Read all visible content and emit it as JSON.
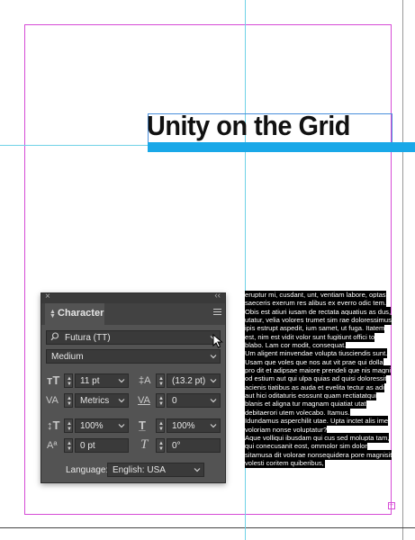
{
  "document": {
    "headline": "Unity on the Grid",
    "body_text": "eruptur mi, cusdant, unt, ventiam labore, optas saeceris exerum res alibus ex everro odic tem. Obis est atiuri iusam de rectata aquatius as dus, utatur, velia volores trumet sim rae doloressimus ipis estrupt aspedit, ium samet, ut fuga. Itatem est, nim est vidit volor sunt fugitiunt offici to blabo. Lam cor modit, consequat.\nUm aligent minvendae volupta tiusciendis sunt.\nUsam que voles que nos aut vit prae qui dolla pro dit et adipsae maiore prendeli que nis magni od estium aut qui ulpa quias ad quisi doloressit acienis tiatibus as auda et evelita tectur as adi aut hici oditaturis eossunt quam rectiatatqui blanis et aligna tur magnam quiatiat utat debitaerori utem volecabo. Itamus.\nIdundamus asperchilit utae. Upta inctet alis ime voloriam nonse voluptatur?\nAque volliqui ibusdam qui cus sed molupta tam, qui conecusanit eost, ommolor sim dolor sitamusa dit volorae nonsequidera pore magnisit volesti coritem quiberibus,"
  },
  "character_panel": {
    "tab_label": "Character",
    "font_family": "Futura (TT)",
    "font_style": "Medium",
    "font_size": "11 pt",
    "leading": "(13.2 pt)",
    "kerning": "Metrics",
    "tracking": "0",
    "vertical_scale": "100%",
    "horizontal_scale": "100%",
    "baseline_shift": "0 pt",
    "skew": "0°",
    "language_label": "Language:",
    "language": "English: USA"
  },
  "icons": {
    "close": "×",
    "collapse": "‹‹",
    "search": "⚲"
  },
  "colors": {
    "margin_guide": "#d64bd6",
    "ruler_guide": "#6fd2e6",
    "headline_bar": "#19a8e8",
    "panel_bg": "#535353"
  }
}
